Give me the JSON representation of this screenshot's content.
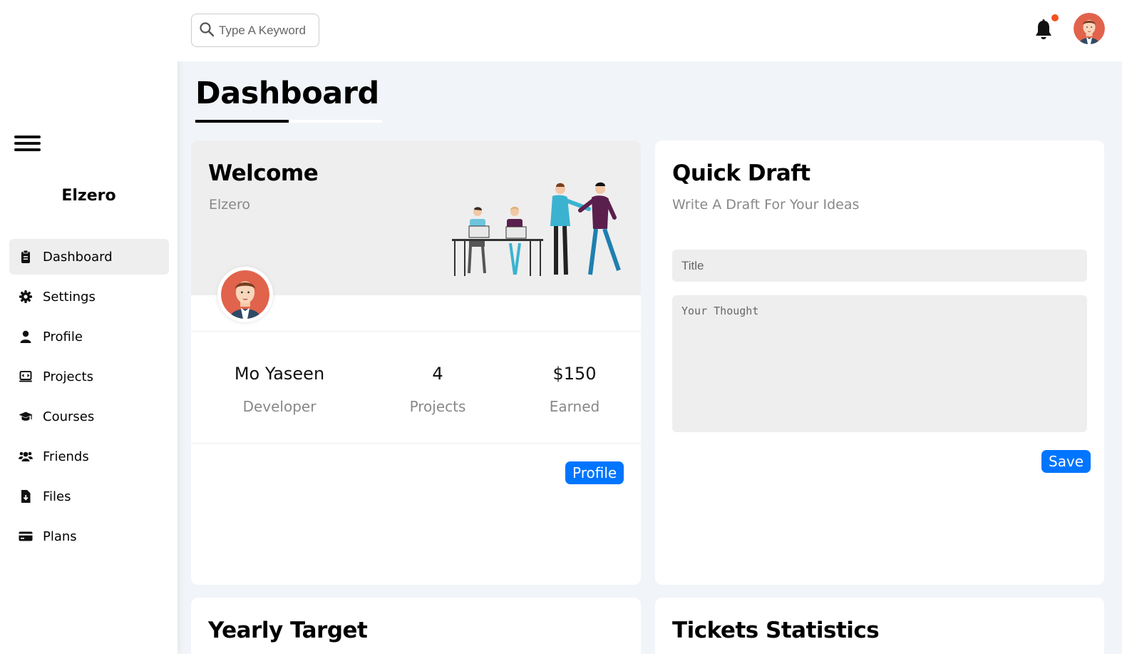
{
  "sidebar": {
    "brand": "Elzero",
    "items": [
      {
        "label": "Dashboard",
        "icon": "clipboard-icon"
      },
      {
        "label": "Settings",
        "icon": "gear-icon"
      },
      {
        "label": "Profile",
        "icon": "user-icon"
      },
      {
        "label": "Projects",
        "icon": "diagram-project-icon"
      },
      {
        "label": "Courses",
        "icon": "graduation-cap-icon"
      },
      {
        "label": "Friends",
        "icon": "users-icon"
      },
      {
        "label": "Files",
        "icon": "file-download-icon"
      },
      {
        "label": "Plans",
        "icon": "credit-card-icon"
      }
    ],
    "active_item": "Dashboard"
  },
  "header": {
    "search_placeholder": "Type A Keyword",
    "notification_dot_color": "#f4511e"
  },
  "page": {
    "title": "Dashboard"
  },
  "welcome": {
    "title": "Welcome",
    "subtitle": "Elzero",
    "stats": [
      {
        "value": "Mo Yaseen",
        "label": "Developer"
      },
      {
        "value": "4",
        "label": "Projects"
      },
      {
        "value": "$150",
        "label": "Earned"
      }
    ],
    "button_label": "Profile"
  },
  "draft": {
    "title": "Quick Draft",
    "subtitle": "Write A Draft For Your Ideas",
    "title_placeholder": "Title",
    "thought_placeholder": "Your Thought",
    "button_label": "Save"
  },
  "yearly": {
    "title": "Yearly Target"
  },
  "tickets": {
    "title": "Tickets Statistics"
  },
  "colors": {
    "accent": "#0075ff",
    "background": "#f1f5f9",
    "panel": "#eeeeee"
  }
}
